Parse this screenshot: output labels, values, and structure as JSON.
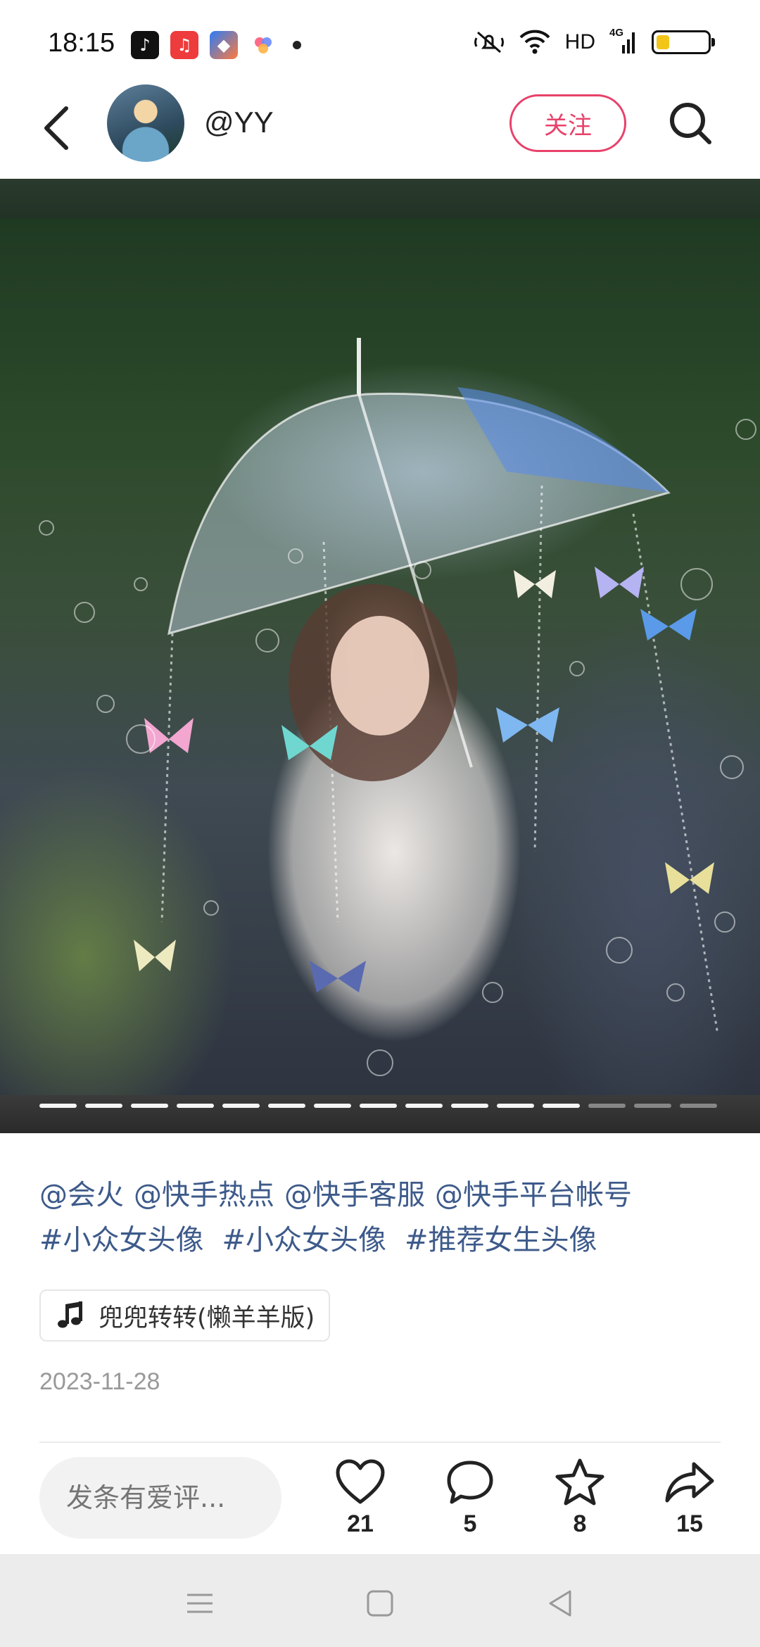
{
  "status_bar": {
    "time": "18:15",
    "network_label": "HD",
    "network_type": "4G",
    "battery_level": 0.25,
    "app_icons": [
      "tiktok-icon",
      "music-icon",
      "shortcut-app-icon",
      "color-app-icon"
    ]
  },
  "header": {
    "username": "@YY",
    "follow_label": "关注"
  },
  "photo": {
    "slide_count": 15,
    "active_slide": 12
  },
  "caption": {
    "mentions": [
      "@会火",
      "@快手热点",
      "@快手客服",
      "@快手平台帐号"
    ],
    "hashtags": [
      "#小众女头像",
      "#小众女头像",
      "#推荐女生头像"
    ]
  },
  "music": {
    "title": "兜兜转转(懒羊羊版)"
  },
  "post": {
    "date": "2023-11-28"
  },
  "action_bar": {
    "comment_placeholder": "发条有爱评...",
    "likes": "21",
    "comments": "5",
    "favorites": "8",
    "shares": "15"
  },
  "colors": {
    "accent": "#e8416a",
    "link": "#3d5a8a"
  }
}
